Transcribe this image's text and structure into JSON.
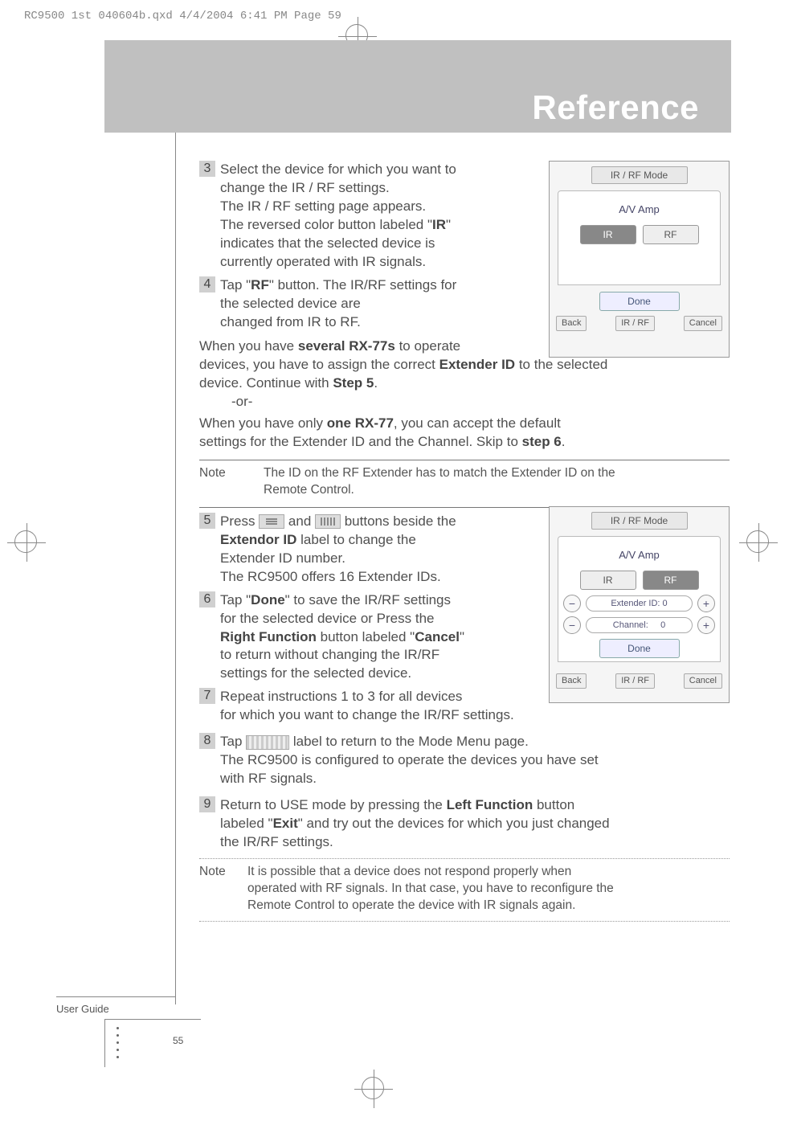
{
  "print_header": "RC9500 1st 040604b.qxd  4/4/2004  6:41 PM  Page 59",
  "header_title": "Reference",
  "steps": {
    "s3": {
      "num": "3",
      "l1": "Select the device for which you want to",
      "l2": "change the IR / RF settings.",
      "l3": "The IR / RF setting page appears.",
      "l4a": "The reversed color button labeled \"",
      "l4b": "IR",
      "l4c": "\"",
      "l5": "indicates that the selected device is",
      "l6": "currently operated with IR signals."
    },
    "s4": {
      "num": "4",
      "l1a": "Tap \"",
      "l1b": "RF",
      "l1c": "\" button. The IR/RF settings for",
      "l2": "the selected device are",
      "l3": "changed from IR to RF."
    },
    "mid": {
      "p1a": "When you have ",
      "p1b": "several RX-77s",
      "p1c": " to operate",
      "p2a": "devices, you have to assign the correct ",
      "p2b": "Extender ID",
      "p2c": " to the selected",
      "p3a": "device. Continue with ",
      "p3b": "Step 5",
      "p3c": ".",
      "or": "-or-",
      "p4a": "When you have only ",
      "p4b": "one RX-77",
      "p4c": ", you can accept the default",
      "p5a": "settings for the Extender ID and the Channel. Skip to ",
      "p5b": "step 6",
      "p5c": "."
    },
    "note1": {
      "label": "Note",
      "l1": "The ID on the RF Extender has to match the Extender ID on the",
      "l2": "Remote Control."
    },
    "s5": {
      "num": "5",
      "l1a": "Press ",
      "l1b": " and ",
      "l1c": " buttons beside the",
      "l2a": "Extendor ID",
      "l2b": " label to change the",
      "l3": "Extender ID number.",
      "l4": "The RC9500 offers 16 Extender IDs."
    },
    "s6": {
      "num": "6",
      "l1a": "Tap \"",
      "l1b": "Done",
      "l1c": "\" to save the IR/RF settings",
      "l2": "for the selected device or Press the",
      "l3a": "Right Function",
      "l3b": " button labeled \"",
      "l3c": "Cancel",
      "l3d": "\"",
      "l4": "to return without changing the IR/RF",
      "l5": "settings for the selected device."
    },
    "s7": {
      "num": "7",
      "l1": "Repeat instructions 1 to 3 for all devices",
      "l2": "for which you want to change the IR/RF settings."
    },
    "s8": {
      "num": "8",
      "l1a": "Tap ",
      "l1b": " label to return to the Mode Menu page.",
      "l2": "The RC9500 is configured to operate the devices you have set",
      "l3": "with RF signals."
    },
    "s9": {
      "num": "9",
      "l1a": "Return to USE mode by pressing the ",
      "l1b": "Left Function",
      "l1c": " button",
      "l2a": "labeled \"",
      "l2b": "Exit",
      "l2c": "\" and try out the devices for which you just changed",
      "l3": "the IR/RF settings."
    },
    "note2": {
      "label": "Note",
      "l1": "It is possible that a device does not respond properly when",
      "l2": "operated with RF signals. In that case, you have to reconfigure the",
      "l3": "Remote Control to operate the device with IR signals again."
    }
  },
  "screens": {
    "s1": {
      "tab": "IR / RF Mode",
      "device": "A/V Amp",
      "ir": "IR",
      "rf": "RF",
      "done": "Done",
      "back": "Back",
      "irrf": "IR / RF",
      "cancel": "Cancel"
    },
    "s2": {
      "tab": "IR / RF Mode",
      "device": "A/V Amp",
      "ir": "IR",
      "rf": "RF",
      "ext_label": "Extender ID:",
      "ext_val": "0",
      "ch_label": "Channel:",
      "ch_val": "0",
      "done": "Done",
      "back": "Back",
      "irrf": "IR / RF",
      "cancel": "Cancel"
    }
  },
  "footer": {
    "user_guide": "User Guide",
    "page": "55"
  }
}
